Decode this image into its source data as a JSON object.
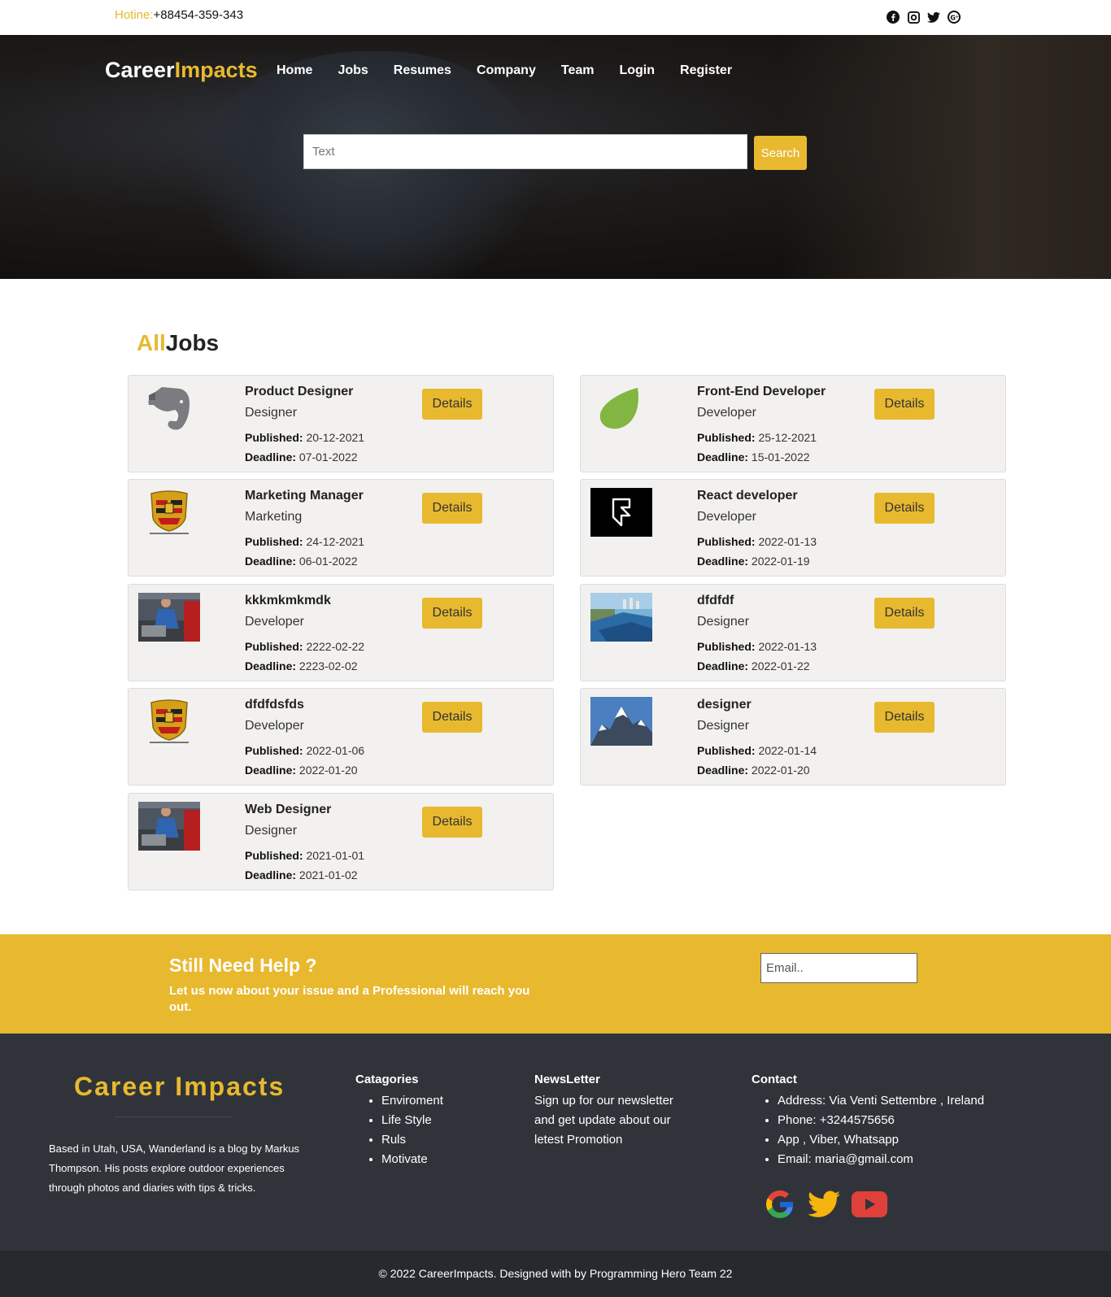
{
  "topbar": {
    "hotline_label": "Hotine:",
    "hotline_number": "+88454-359-343",
    "socials": [
      "facebook-icon",
      "instagram-icon",
      "twitter-icon",
      "google-plus-icon"
    ]
  },
  "header": {
    "brand_part1": "Career",
    "brand_part2": "Impacts",
    "nav": [
      "Home",
      "Jobs",
      "Resumes",
      "Company",
      "Team",
      "Login",
      "Register"
    ],
    "search_placeholder": "Text",
    "search_button": "Search"
  },
  "jobs": {
    "title_part1": "All",
    "title_part2": "Jobs",
    "published_label": "Published:",
    "deadline_label": "Deadline:",
    "details_label": "Details",
    "items": [
      {
        "title": "Product Designer",
        "category": "Designer",
        "published": "20-12-2021",
        "deadline": "07-01-2022",
        "logo": "evernote-logo"
      },
      {
        "title": "Front-End Developer",
        "category": "Developer",
        "published": "25-12-2021",
        "deadline": "15-01-2022",
        "logo": "envato-logo"
      },
      {
        "title": "Marketing Manager",
        "category": "Marketing",
        "published": "24-12-2021",
        "deadline": "06-01-2022",
        "logo": "porsche-logo"
      },
      {
        "title": "React developer",
        "category": "Developer",
        "published": "2022-01-13",
        "deadline": "2022-01-19",
        "logo": "framer-logo"
      },
      {
        "title": "kkkmkmkmdk",
        "category": "Developer",
        "published": "2222-02-22",
        "deadline": "2223-02-02",
        "logo": "mechanic-photo"
      },
      {
        "title": "dfdfdf",
        "category": "Designer",
        "published": "2022-01-13",
        "deadline": "2022-01-22",
        "logo": "coast-photo"
      },
      {
        "title": "dfdfdsfds",
        "category": "Developer",
        "published": "2022-01-06",
        "deadline": "2022-01-20",
        "logo": "porsche-logo"
      },
      {
        "title": "designer",
        "category": "Designer",
        "published": "2022-01-14",
        "deadline": "2022-01-20",
        "logo": "mountain-photo"
      },
      {
        "title": "Web Designer",
        "category": "Designer",
        "published": "2021-01-01",
        "deadline": "2021-01-02",
        "logo": "mechanic-photo"
      }
    ]
  },
  "help": {
    "title": "Still Need Help ?",
    "text": "Let us now about your issue and a Professional will reach you out.",
    "email_placeholder": "Email.."
  },
  "footer": {
    "brand": "Career Impacts",
    "about": "Based in Utah, USA, Wanderland is a blog by Markus Thompson. His posts explore outdoor experiences through photos and diaries with tips & tricks.",
    "categories_title": "Catagories",
    "categories": [
      "Enviroment",
      "Life Style",
      "Ruls",
      "Motivate"
    ],
    "newsletter_title": "NewsLetter",
    "newsletter_text": "Sign up for our newsletter and get update about our letest Promotion",
    "contact_title": "Contact",
    "contact": [
      "Address: Via Venti Settembre , Ireland",
      "Phone: +3244575656",
      "App , Viber, Whatsapp",
      "Email: maria@gmail.com"
    ],
    "icons": [
      "google-icon",
      "twitter-icon",
      "youtube-icon"
    ],
    "copyright": "© 2022 CareerImpacts. Designed with by Programming Hero Team 22"
  },
  "colors": {
    "accent": "#e8b92f",
    "footer": "#30343a",
    "copyright_bar": "#26292e",
    "card": "#f2f1ef"
  }
}
